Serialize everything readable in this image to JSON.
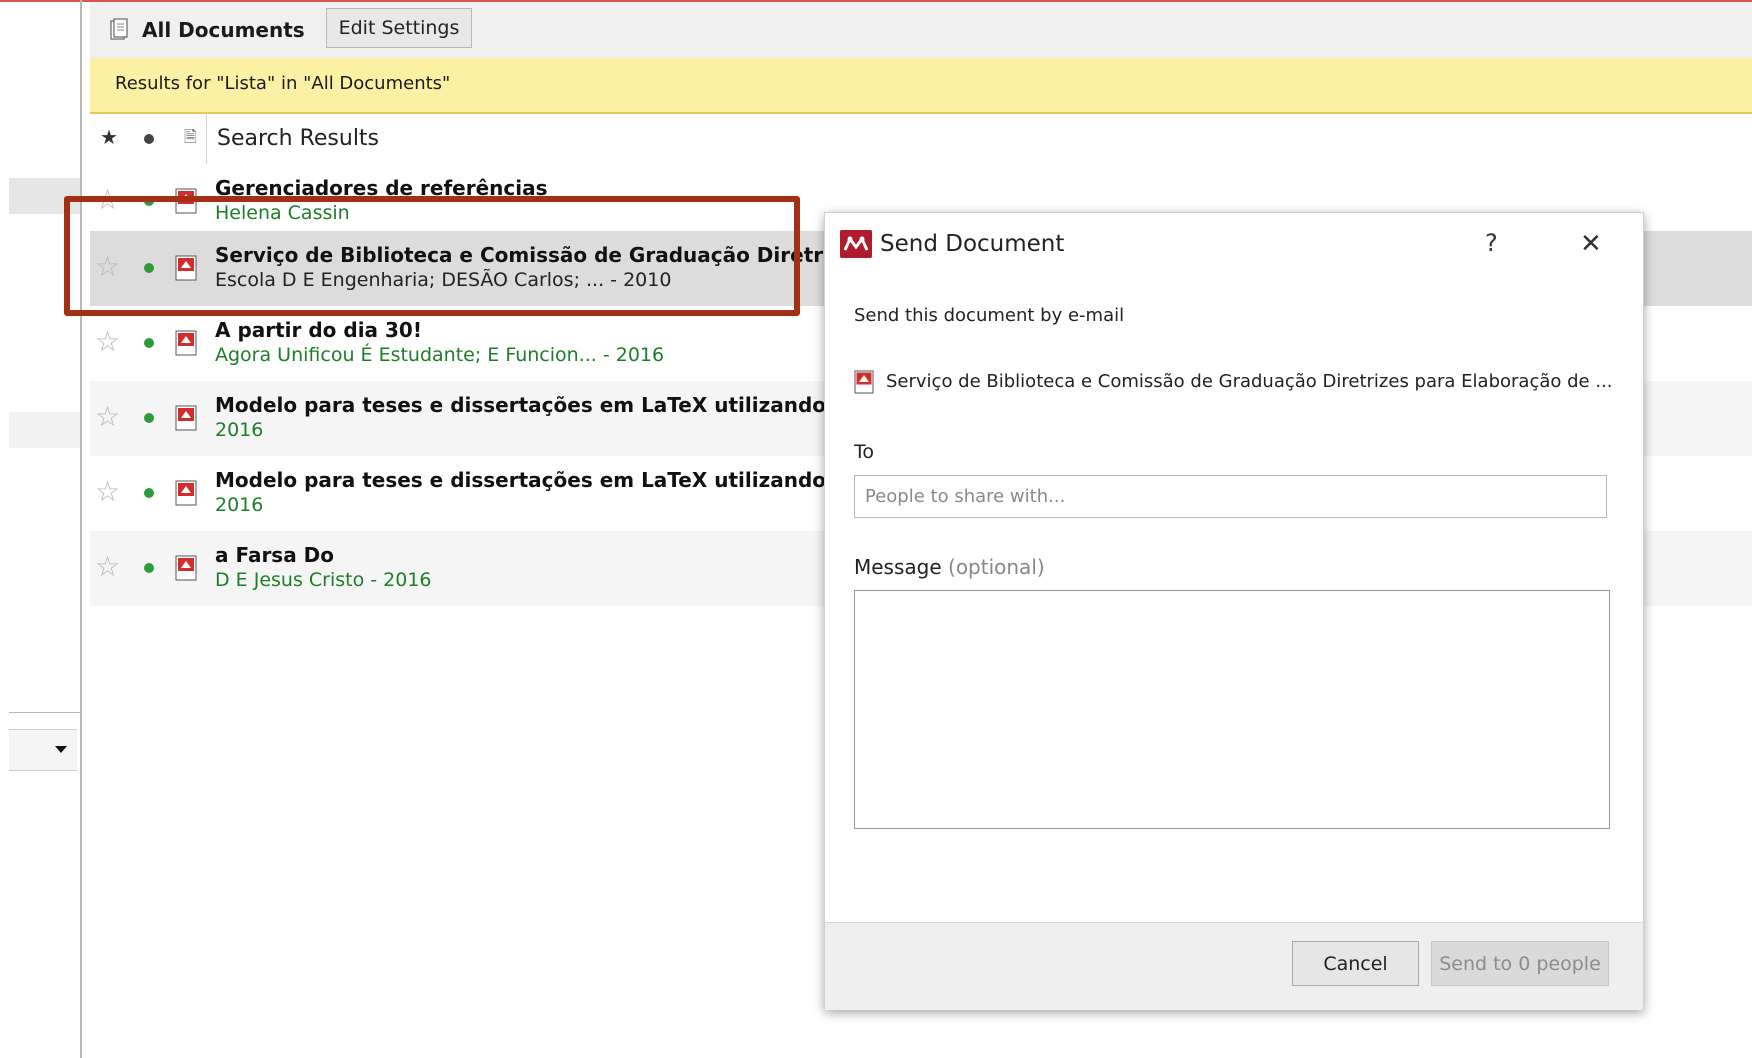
{
  "toolbar": {
    "library_title": "All Documents",
    "edit_settings_label": "Edit Settings"
  },
  "banner": {
    "text": "Results for \"Lista\" in \"All Documents\""
  },
  "list_header": {
    "title": "Search Results"
  },
  "documents": [
    {
      "title": "Gerenciadores de referências",
      "meta": "Helena Cassin"
    },
    {
      "title": "Serviço de Biblioteca e Comissão de Graduação Diretrizes",
      "meta": "Escola D E Engenharia; DESÃO Carlos; ... - 2010"
    },
    {
      "title": "A partir do dia 30!",
      "meta": "Agora Unificou É Estudante; E Funcion... - 2016"
    },
    {
      "title": "Modelo para teses e dissertações em LaTeX utilizando a c",
      "meta": "2016"
    },
    {
      "title": "Modelo para teses e dissertações em LaTeX utilizando a c",
      "meta": "2016"
    },
    {
      "title": "a Farsa Do",
      "meta": "D E Jesus Cristo - 2016"
    }
  ],
  "dialog": {
    "title": "Send Document",
    "help": "?",
    "close": "✕",
    "subtitle": "Send this document by e-mail",
    "document_name": "Serviço de Biblioteca e Comissão de Graduação Diretrizes para Elaboração de ...",
    "to_label": "To",
    "to_placeholder": "People to share with...",
    "message_label": "Message",
    "message_optional": "(optional)",
    "cancel_label": "Cancel",
    "send_label": "Send to 0 people"
  },
  "colors": {
    "accent": "#b01c2e",
    "banner_bg": "#fcf0a4",
    "highlight_border": "#a33014",
    "meta_green": "#1e7d2b",
    "unread_dot": "#2f9a3a"
  },
  "icons": {
    "library": "library-icon",
    "pdf": "pdf-icon",
    "star": "star-icon",
    "unread": "unread-dot-icon",
    "logo": "mendeley-logo-icon"
  }
}
